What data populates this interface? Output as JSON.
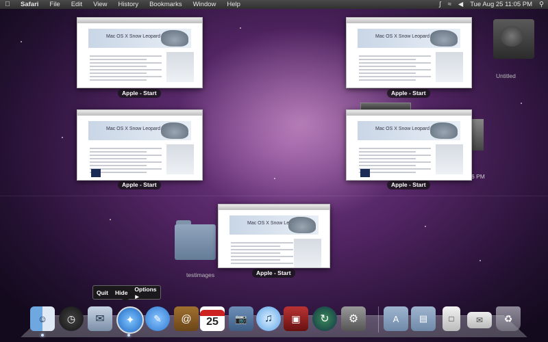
{
  "menubar": {
    "apple": "",
    "items": [
      "Safari",
      "File",
      "Edit",
      "View",
      "History",
      "Bookmarks",
      "Window",
      "Help"
    ],
    "clock": "Tue Aug 25  11:05 PM",
    "status_icons": [
      "bluetooth-icon",
      "wifi-icon",
      "volume-icon",
      "spotlight-icon"
    ]
  },
  "windows": [
    {
      "title": "Apple - Start",
      "banner": "Mac OS X Snow Leopard"
    },
    {
      "title": "Apple - Start",
      "banner": "Mac OS X Snow Leopard"
    },
    {
      "title": "Apple - Start",
      "banner": "Mac OS X Snow Leopard"
    },
    {
      "title": "Apple - Start",
      "banner": "Mac OS X Snow Leopard"
    },
    {
      "title": "Apple - Start",
      "banner": "Mac OS X Snow Leopard"
    }
  ],
  "desktop": {
    "hd_label": "Untitled",
    "folder_label": "testimages",
    "clock_fragment": "6 PM"
  },
  "context_menu": {
    "quit": "Quit",
    "hide": "Hide",
    "options": "Options"
  },
  "dock": {
    "calendar_day": "25",
    "icons": [
      "finder-icon",
      "dashboard-icon",
      "mail-icon",
      "safari-icon",
      "ichat-icon",
      "address-book-icon",
      "ical-icon",
      "preview-icon",
      "itunes-icon",
      "photo-booth-icon",
      "time-machine-icon",
      "system-preferences-icon",
      "applications-folder-icon",
      "documents-folder-icon",
      "downloads-stack-icon",
      "mail-stack-icon",
      "trash-icon"
    ]
  },
  "colors": {
    "accent": "#2a78c8"
  }
}
